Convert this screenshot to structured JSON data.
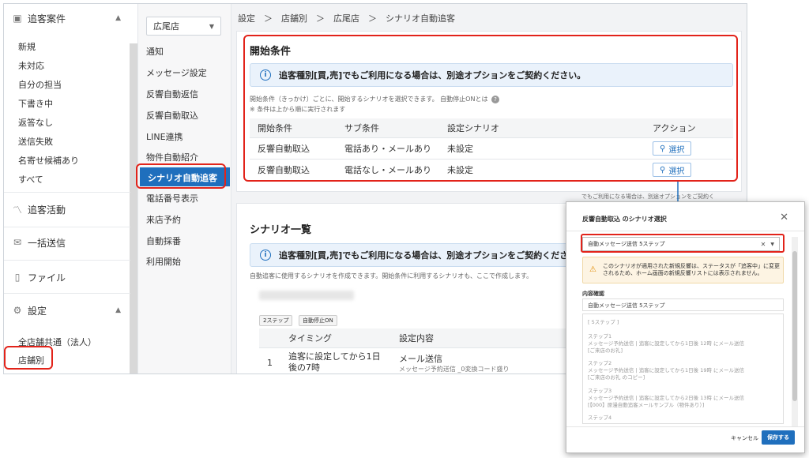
{
  "sidebar": {
    "section_customers": "追客案件",
    "items": [
      "新規",
      "未対応",
      "自分の担当",
      "下書き中",
      "返答なし",
      "送信失敗",
      "名寄せ候補あり",
      "すべて"
    ],
    "section_activity": "追客活動",
    "section_bulk": "一括送信",
    "section_file": "ファイル",
    "section_settings": "設定",
    "settings_items": [
      "全店舗共通（法人）",
      "店舗別"
    ]
  },
  "subnav": {
    "store": "広尾店",
    "items": [
      "通知",
      "メッセージ設定",
      "反響自動返信",
      "反響自動取込",
      "LINE連携",
      "物件自動紹介",
      "シナリオ自動追客",
      "電話番号表示",
      "来店予約",
      "自動採番",
      "利用開始"
    ]
  },
  "breadcrumb": "設定　＞　店舗別　＞　広尾店　＞　シナリオ自動追客",
  "start_conditions": {
    "title": "開始条件",
    "notice": "追客種別[買,売]でもご利用になる場合は、別途オプションをご契約ください。",
    "desc1": "開始条件（きっかけ）ごとに、開始するシナリオを選択できます。 自動停止ONとは",
    "desc2": "※ 条件は上から順に実行されます",
    "headers": [
      "開始条件",
      "サブ条件",
      "設定シナリオ",
      "アクション"
    ],
    "rows": [
      [
        "反響自動取込",
        "電話あり・メールあり",
        "未設定"
      ],
      [
        "反響自動取込",
        "電話なし・メールあり",
        "未設定"
      ]
    ],
    "select_label": "選択"
  },
  "scenario_list": {
    "title": "シナリオ一覧",
    "notice": "追客種別[買,売]でもご利用になる場合は、別途オプションをご契約ください。",
    "desc": "自動追客に使用するシナリオを作成できます。開始条件に利用するシナリオも、ここで作成します。",
    "tags": [
      "2ステップ",
      "自動停止ON"
    ],
    "headers": [
      "タイミング",
      "設定内容"
    ],
    "rows": [
      {
        "num": "1",
        "timing": "追客に設定してから1日後の7時",
        "content": "メール送信",
        "sub": "メッセージ予約送信 _0変換コード盛り"
      }
    ],
    "overlap_text": "でもご利用になる場合は、別途オプションをご契約く"
  },
  "modal": {
    "title": "反響自動取込 のシナリオ選択",
    "selected": "自動メッセージ送信 5ステップ",
    "warning": "このシナリオが適用された新規反響は、ステータスが「追客中」に変更されるため、ホーム画面の新規反響リストには表示されません。",
    "content_label": "内容確認",
    "content_name": "自動メッセージ送信 5ステップ",
    "lines": [
      "[ 5ステップ ]",
      "ステップ1",
      "メッセージ予約送信 | 追客に設定してから1日後 12時 にメール送信",
      "[ご来店のお礼]",
      "ステップ2",
      "メッセージ予約送信 | 追客に設定してから1日後 19時 にメール送信",
      "[ご来店のお礼 のコピー]",
      "ステップ3",
      "メッセージ予約送信 | 追客に設定してから2日後 13時 にメール送信",
      "[【000】原漫自動追客メールサンプル（物件あり）]",
      "ステップ4"
    ],
    "cancel": "キャンセル",
    "save": "保存する"
  },
  "colors": {
    "accent": "#1f6fbd",
    "highlight": "#e2231a"
  }
}
